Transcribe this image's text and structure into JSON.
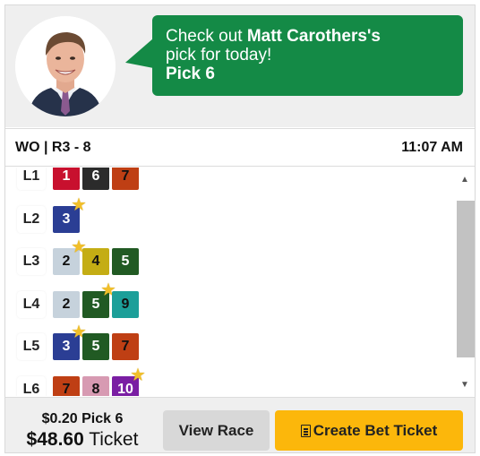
{
  "header": {
    "message_prefix": "Check out ",
    "handicapper_name": "Matt Carothers's",
    "message_suffix": "pick for today!",
    "bet_name": "Pick 6"
  },
  "race": {
    "id": "WO | R3 - 8",
    "time": "11:07 AM"
  },
  "legs": [
    {
      "label": "L1",
      "picks": [
        {
          "num": "1",
          "bg": "#c8102e",
          "fg": "#ffffff",
          "star": true
        },
        {
          "num": "6",
          "bg": "#2b2b2b",
          "fg": "#ffffff",
          "star": false
        },
        {
          "num": "7",
          "bg": "#bf3f14",
          "fg": "#111111",
          "star": false
        }
      ]
    },
    {
      "label": "L2",
      "picks": [
        {
          "num": "3",
          "bg": "#2b3e94",
          "fg": "#ffffff",
          "star": true
        }
      ]
    },
    {
      "label": "L3",
      "picks": [
        {
          "num": "2",
          "bg": "#c6d2dc",
          "fg": "#111111",
          "star": true
        },
        {
          "num": "4",
          "bg": "#c4ad14",
          "fg": "#111111",
          "star": false
        },
        {
          "num": "5",
          "bg": "#215a23",
          "fg": "#ffffff",
          "star": false
        }
      ]
    },
    {
      "label": "L4",
      "picks": [
        {
          "num": "2",
          "bg": "#c6d2dc",
          "fg": "#111111",
          "star": false
        },
        {
          "num": "5",
          "bg": "#215a23",
          "fg": "#ffffff",
          "star": true
        },
        {
          "num": "9",
          "bg": "#1c9f99",
          "fg": "#111111",
          "star": false
        }
      ]
    },
    {
      "label": "L5",
      "picks": [
        {
          "num": "3",
          "bg": "#2b3e94",
          "fg": "#ffffff",
          "star": true
        },
        {
          "num": "5",
          "bg": "#215a23",
          "fg": "#ffffff",
          "star": false
        },
        {
          "num": "7",
          "bg": "#bf3f14",
          "fg": "#111111",
          "star": false
        }
      ]
    },
    {
      "label": "L6",
      "picks": [
        {
          "num": "7",
          "bg": "#bf3f14",
          "fg": "#111111",
          "star": false
        },
        {
          "num": "8",
          "bg": "#d79ab2",
          "fg": "#111111",
          "star": false
        },
        {
          "num": "10",
          "bg": "#7a1ea3",
          "fg": "#ffffff",
          "star": true
        }
      ]
    }
  ],
  "footer": {
    "bet_type": "$0.20 Pick 6",
    "total_amount": "$48.60",
    "total_suffix": " Ticket",
    "view_race_label": "View Race",
    "create_ticket_label": "Create Bet Ticket"
  },
  "icons": {
    "star": "star-icon",
    "ticket": "ticket-icon",
    "scroll_up": "chevron-up-icon",
    "scroll_down": "chevron-down-icon"
  }
}
